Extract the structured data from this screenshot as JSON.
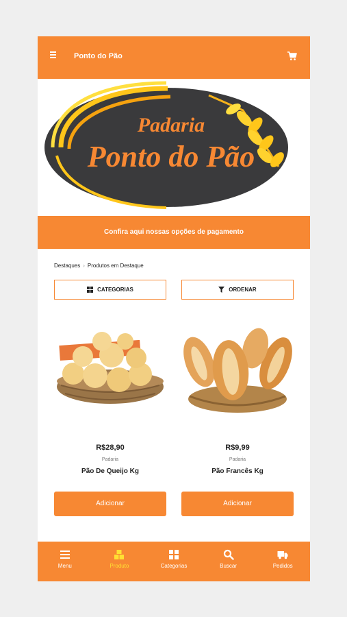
{
  "header": {
    "title": "Ponto do Pão",
    "menu_icon": "menu-icon",
    "cart_icon": "cart-icon"
  },
  "banner": {
    "logo_line1": "Padaria",
    "logo_line2": "Ponto do Pão"
  },
  "payment_bar": {
    "label": "Confira aqui nossas opções de pagamento"
  },
  "breadcrumb": {
    "items": [
      "Destaques",
      "Produtos em Destaque"
    ]
  },
  "filters": {
    "categories_label": "CATEGORIAS",
    "order_label": "ORDENAR"
  },
  "products": [
    {
      "price": "R$28,90",
      "category": "Padaria",
      "name": "Pão De Queijo Kg",
      "button": "Adicionar"
    },
    {
      "price": "R$9,99",
      "category": "Padaria",
      "name": "Pão Francês Kg",
      "button": "Adicionar"
    }
  ],
  "bottom_nav": {
    "items": [
      {
        "label": "Menu",
        "icon": "menu-icon"
      },
      {
        "label": "Produto",
        "icon": "boxes-icon",
        "active": true
      },
      {
        "label": "Categorias",
        "icon": "grid-icon"
      },
      {
        "label": "Buscar",
        "icon": "search-icon"
      },
      {
        "label": "Pedidos",
        "icon": "truck-icon"
      }
    ]
  },
  "colors": {
    "primary": "#f78833",
    "active": "#ffe033",
    "logo_bg": "#3a3a3c",
    "logo_text": "#f78833"
  }
}
